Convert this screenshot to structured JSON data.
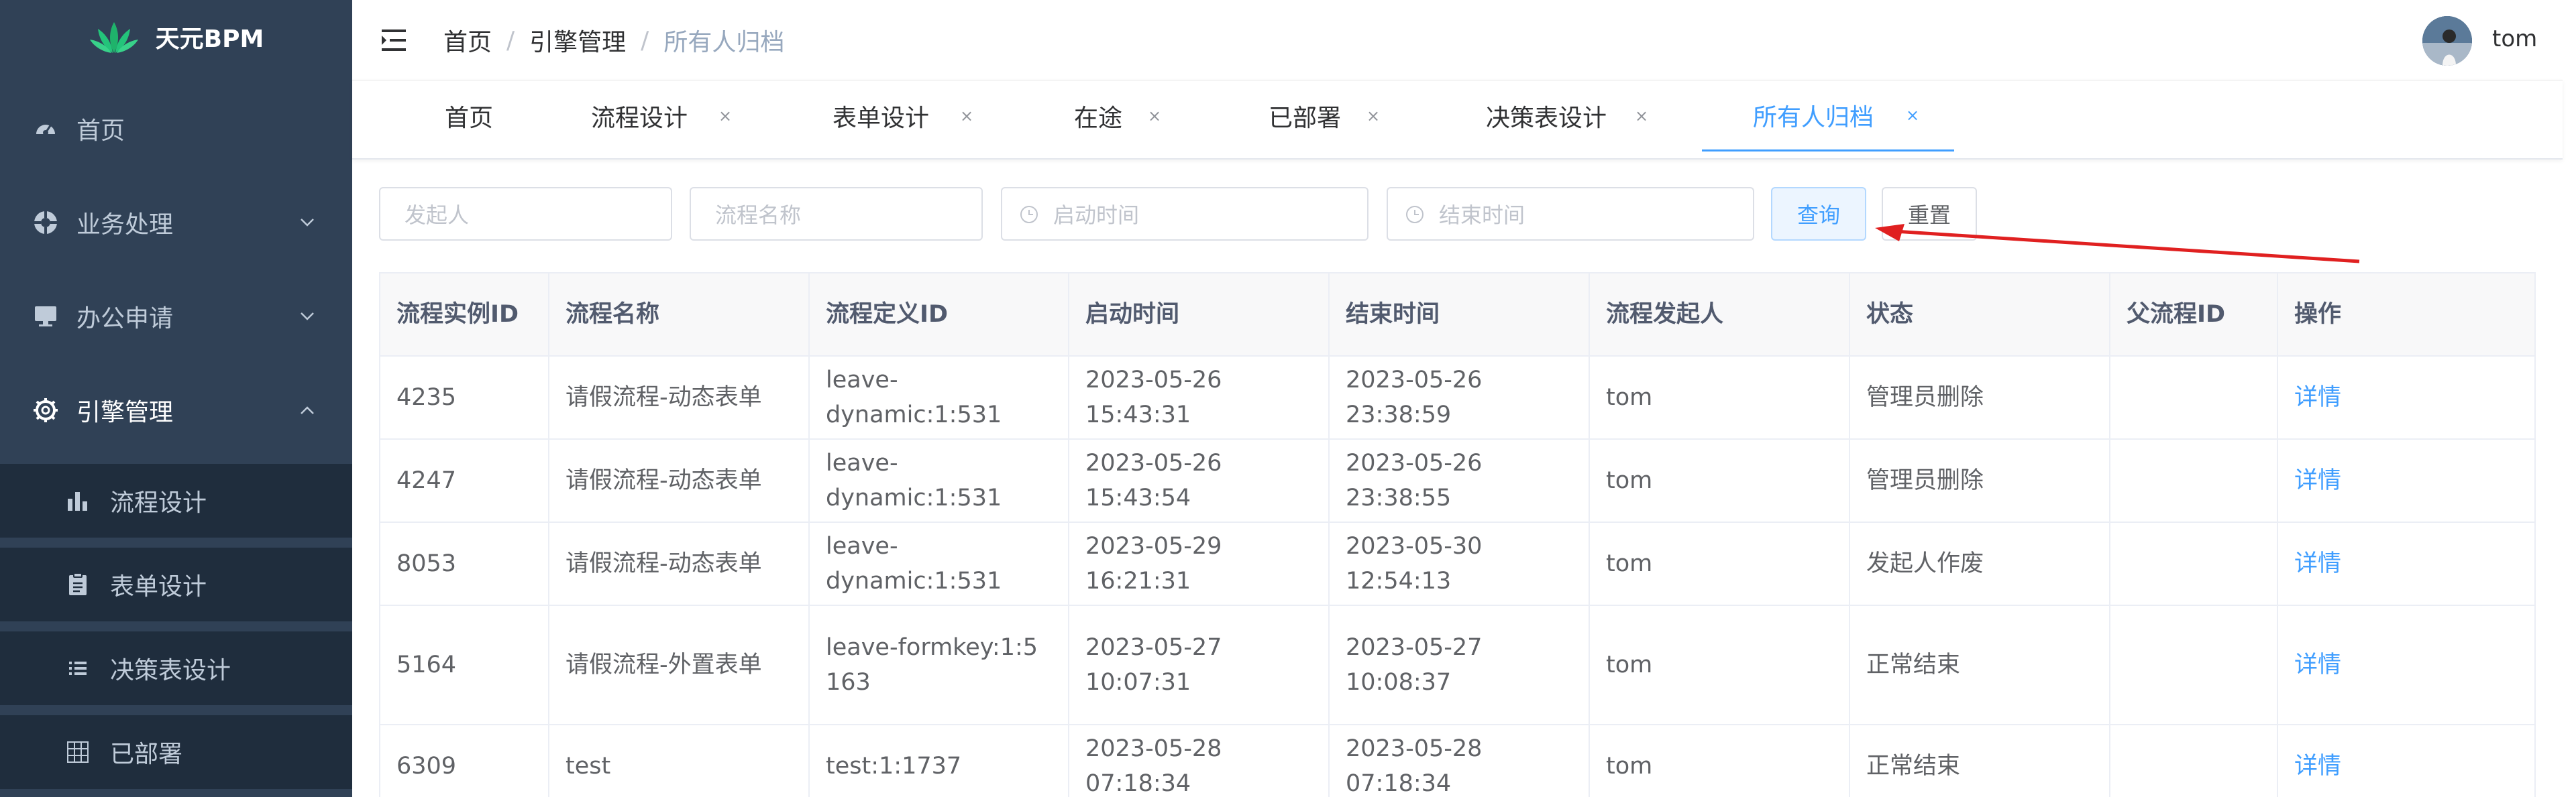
{
  "app": {
    "name": "天元BPM"
  },
  "sidebar": {
    "items": [
      {
        "label": "首页",
        "icon": "dashboard-icon"
      },
      {
        "label": "业务处理",
        "icon": "lifebuoy-icon"
      },
      {
        "label": "办公申请",
        "icon": "monitor-icon"
      },
      {
        "label": "引擎管理",
        "icon": "gear-icon"
      }
    ],
    "subitems": [
      {
        "label": "流程设计",
        "icon": "bar-chart-icon"
      },
      {
        "label": "表单设计",
        "icon": "clipboard-icon"
      },
      {
        "label": "决策表设计",
        "icon": "list-icon"
      },
      {
        "label": "已部署",
        "icon": "grid-icon"
      }
    ]
  },
  "navbar": {
    "breadcrumb": [
      "首页",
      "引擎管理",
      "所有人归档"
    ],
    "separator": "/",
    "user": "tom"
  },
  "tags": [
    {
      "label": "首页",
      "closable": false
    },
    {
      "label": "流程设计",
      "closable": true
    },
    {
      "label": "表单设计",
      "closable": true
    },
    {
      "label": "在途",
      "closable": true
    },
    {
      "label": "已部署",
      "closable": true
    },
    {
      "label": "决策表设计",
      "closable": true
    },
    {
      "label": "所有人归档",
      "closable": true,
      "active": true
    }
  ],
  "tag_close": "×",
  "filters": {
    "initiator_placeholder": "发起人",
    "process_name_placeholder": "流程名称",
    "start_time_placeholder": "启动时间",
    "end_time_placeholder": "结束时间",
    "query_label": "查询",
    "reset_label": "重置"
  },
  "table": {
    "columns": [
      "流程实例ID",
      "流程名称",
      "流程定义ID",
      "启动时间",
      "结束时间",
      "流程发起人",
      "状态",
      "父流程ID",
      "操作"
    ],
    "rows": [
      {
        "id": "4235",
        "name": "请假流程-动态表单",
        "def": "leave-dynamic:1:531",
        "start": "2023-05-26 15:43:31",
        "end": "2023-05-26 23:38:59",
        "initiator": "tom",
        "status": "管理员删除",
        "parent": "",
        "action": "详情"
      },
      {
        "id": "4247",
        "name": "请假流程-动态表单",
        "def": "leave-dynamic:1:531",
        "start": "2023-05-26 15:43:54",
        "end": "2023-05-26 23:38:55",
        "initiator": "tom",
        "status": "管理员删除",
        "parent": "",
        "action": "详情"
      },
      {
        "id": "8053",
        "name": "请假流程-动态表单",
        "def": "leave-dynamic:1:531",
        "start": "2023-05-29 16:21:31",
        "end": "2023-05-30 12:54:13",
        "initiator": "tom",
        "status": "发起人作废",
        "parent": "",
        "action": "详情"
      },
      {
        "id": "5164",
        "name": "请假流程-外置表单",
        "def": "leave-formkey:1:5163",
        "start": "2023-05-27 10:07:31",
        "end": "2023-05-27 10:08:37",
        "initiator": "tom",
        "status": "正常结束",
        "parent": "",
        "action": "详情"
      },
      {
        "id": "6309",
        "name": "test",
        "def": "test:1:1737",
        "start": "2023-05-28 07:18:34",
        "end": "2023-05-28 07:18:34",
        "initiator": "tom",
        "status": "正常结束",
        "parent": "",
        "action": "详情"
      }
    ]
  },
  "colors": {
    "sidebar_bg": "#304156",
    "accent": "#409eff",
    "annotation_arrow": "#e02020"
  }
}
